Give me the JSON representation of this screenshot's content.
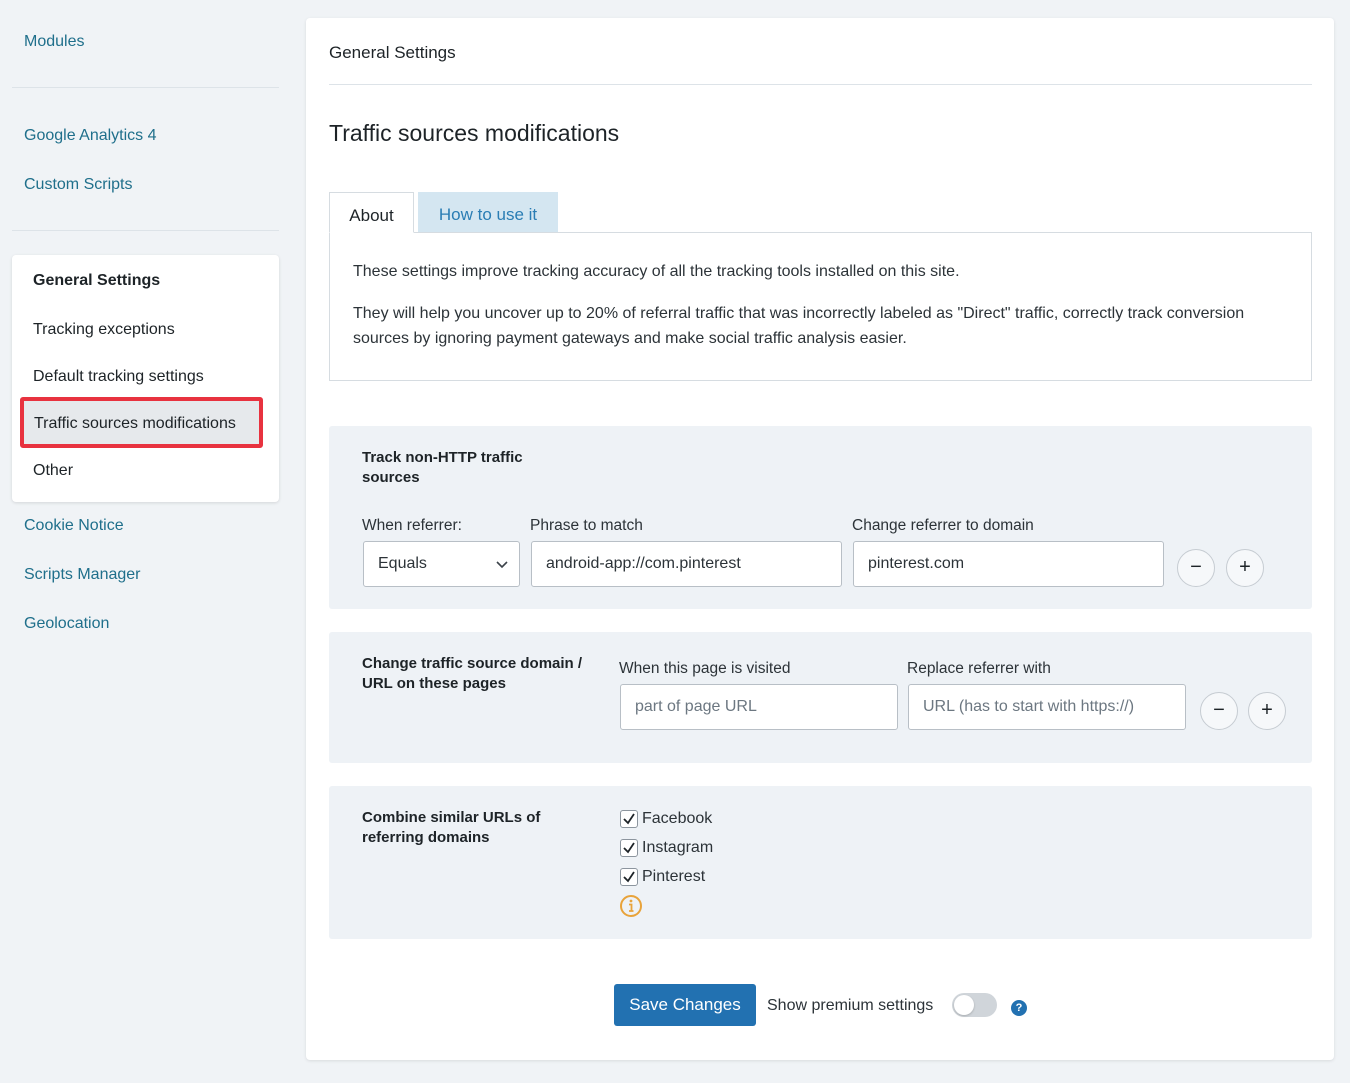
{
  "sidebar": {
    "top_links": [
      "Modules",
      "Google Analytics 4",
      "Custom Scripts"
    ],
    "section": {
      "title": "General Settings",
      "items": [
        "Tracking exceptions",
        "Default tracking settings",
        "Traffic sources modifications",
        "Other"
      ],
      "active": "Traffic sources modifications"
    },
    "bottom_links": [
      "Cookie Notice",
      "Scripts Manager",
      "Geolocation"
    ]
  },
  "main": {
    "header": "General Settings",
    "title": "Traffic sources modifications",
    "tabs": [
      {
        "label": "About"
      },
      {
        "label": "How to use it"
      }
    ],
    "about": {
      "p1": "These settings improve tracking accuracy of all the tracking tools installed on this site.",
      "p2": "They will help you uncover up to 20% of referral traffic that was incorrectly labeled as \"Direct\" traffic, correctly track conversion sources by ignoring payment gateways and make social traffic analysis easier."
    },
    "non_http": {
      "label": "Track non-HTTP traffic sources",
      "when_label": "When referrer:",
      "phrase_label": "Phrase to match",
      "change_label": "Change referrer to domain",
      "when_value": "Equals",
      "phrase_value": "android-app://com.pinterest",
      "change_value": "pinterest.com",
      "minus": "−",
      "plus": "+"
    },
    "change_domain": {
      "label": "Change traffic source domain / URL on these pages",
      "page_label": "When this page is visited",
      "replace_label": "Replace referrer with",
      "page_placeholder": "part of page URL",
      "replace_placeholder": "URL (has to start with https://)",
      "minus": "−",
      "plus": "+"
    },
    "combine": {
      "label": "Combine similar URLs of referring domains",
      "options": [
        {
          "label": "Facebook",
          "checked": true
        },
        {
          "label": "Instagram",
          "checked": true
        },
        {
          "label": "Pinterest",
          "checked": true
        }
      ],
      "info_icon": "info-circle-icon",
      "info_color": "#e8a33a"
    },
    "footer": {
      "save": "Save Changes",
      "premium": "Show premium settings",
      "premium_on": false,
      "help": "?"
    }
  },
  "colors": {
    "link": "#1f6f8b",
    "primary": "#2271b1",
    "highlight": "#e8323f",
    "card_bg": "#eef2f6"
  }
}
